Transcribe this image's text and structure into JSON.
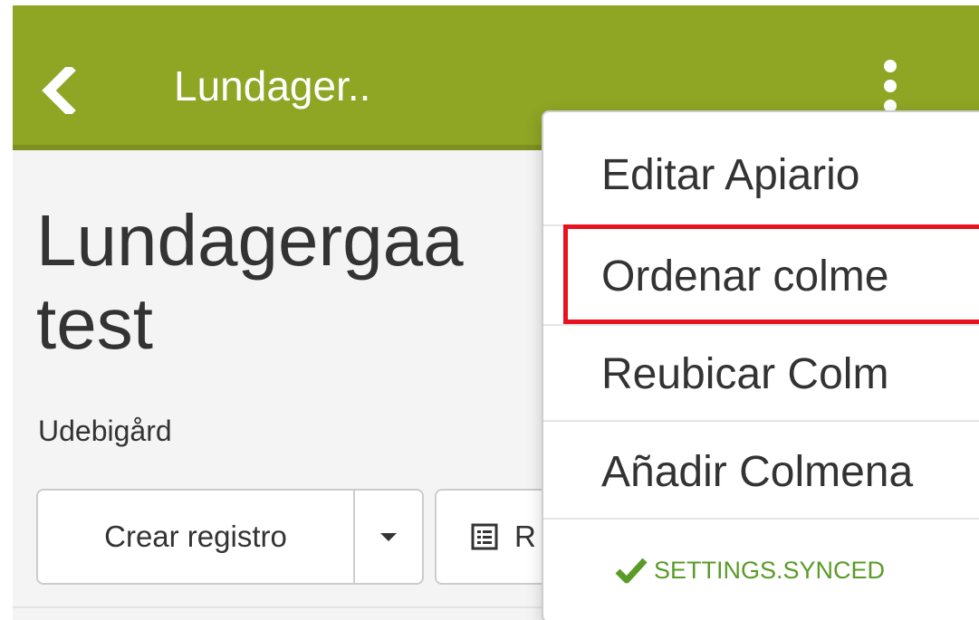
{
  "topbar": {
    "back_icon": "chevron-left-icon",
    "title": "Lundager..",
    "menu_icon": "kebab-menu-icon",
    "background": "#8fa524"
  },
  "page": {
    "title": "Lundagergaa\ntest",
    "subtitle": "Udebigård"
  },
  "actions": {
    "create_record_label": "Crear registro",
    "records_label": "R",
    "records_icon": "list-icon"
  },
  "menu": {
    "items": [
      {
        "label": "Editar Apiario"
      },
      {
        "label": "Ordenar colme"
      },
      {
        "label": "Reubicar Colm"
      },
      {
        "label": "Añadir Colmena"
      }
    ],
    "highlighted_index": 1,
    "highlight_color": "#e8121e",
    "sync_status": "SETTINGS.SYNCED",
    "sync_icon": "check-icon",
    "sync_color": "#5a9b27"
  }
}
